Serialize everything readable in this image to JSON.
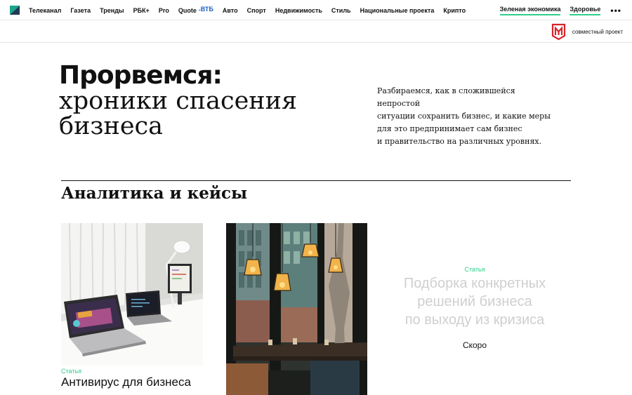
{
  "nav": {
    "items": [
      "Телеканал",
      "Газета",
      "Тренды",
      "РБК+",
      "Pro",
      "Quote",
      "Авто",
      "Спорт",
      "Недвижимость",
      "Стиль",
      "Национальные проекта",
      "Крипто"
    ],
    "quote_partner": "ВТБ",
    "right_items": [
      "Зеленая экономика",
      "Здоровье"
    ],
    "more_icon": "ellipsis-icon",
    "accent_color": "#2ecf8a"
  },
  "partner": {
    "label": "совместный проект",
    "logo_icon": "msp-logo-icon",
    "logo_color": "#d6242b"
  },
  "hero": {
    "title": "Прорвемся:",
    "subtitle_line1": "хроники спасения",
    "subtitle_line2": "бизнеса",
    "description": [
      "Разбираемся, как в сложившейся непростой",
      "ситуации сохранить бизнес, и какие меры",
      "для это предпринимает сам бизнес",
      "и правительство на различных уровнях."
    ]
  },
  "section": {
    "title": "Аналитика и кейсы"
  },
  "cards": [
    {
      "tag": "Статья",
      "title": "Антивирус для бизнеса",
      "image": "laptops-on-desk-photo"
    },
    {
      "tag": "",
      "title": "",
      "image": "cafe-interior-photo"
    },
    {
      "tag": "Статья",
      "title_lines": [
        "Подборка конкретных",
        "решений бизнеса",
        "по выходу из кризиса"
      ],
      "status": "Скоро"
    }
  ]
}
